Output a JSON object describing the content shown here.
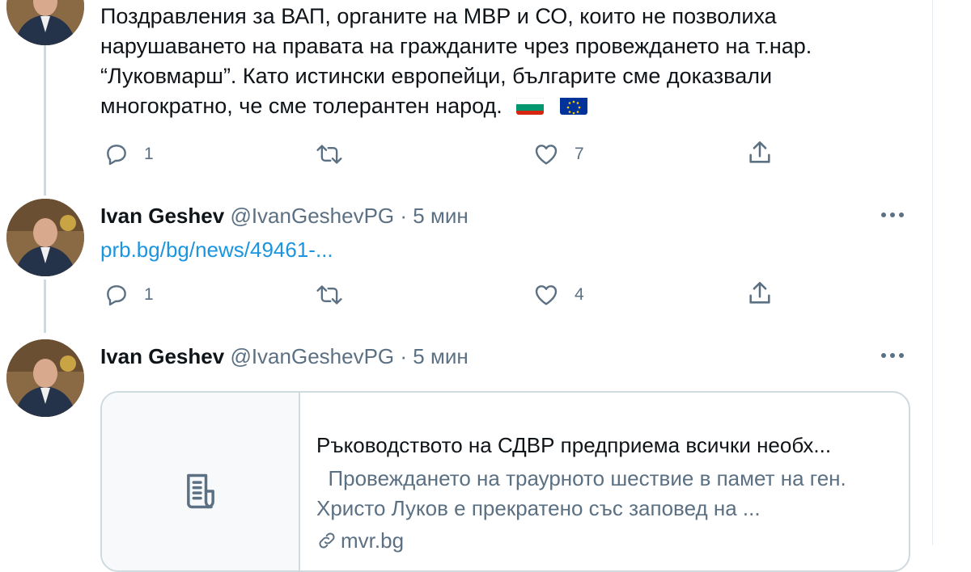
{
  "tweet1": {
    "text_lines": [
      "Поздравления за ВАП, органите на МВР и СО, които не позволиха",
      "нарушаването на правата на гражданите чрез провеждането на т.нар.",
      "“Луковмарш”. Като истински европейци, българите сме доказвали",
      "многократно, че сме толерантен народ."
    ],
    "emoji": [
      "bulgarian-flag",
      "eu-flag"
    ],
    "reply_count": "1",
    "like_count": "7"
  },
  "tweet2": {
    "author": "Ivan Geshev",
    "handle": "@IvanGeshevPG",
    "separator": "·",
    "time": "5 мин",
    "link": "prb.bg/bg/news/49461-...",
    "reply_count": "1",
    "like_count": "4"
  },
  "tweet3": {
    "author": "Ivan Geshev",
    "handle": "@IvanGeshevPG",
    "separator": "·",
    "time": "5 мин",
    "card": {
      "title": "Ръководството на СДВР предприема всички необх...",
      "description": "  Провеждането на траурното шествие в памет на ген. Христо Луков е прекратено със заповед на ...",
      "domain": "mvr.bg"
    }
  },
  "icons": [
    "reply-icon",
    "retweet-icon",
    "like-icon",
    "share-icon",
    "more-icon",
    "article-icon",
    "link-icon"
  ],
  "colors": {
    "text": "#0f1419",
    "secondary": "#5b7083",
    "link": "#1b95e0",
    "border": "#cfd9de"
  }
}
